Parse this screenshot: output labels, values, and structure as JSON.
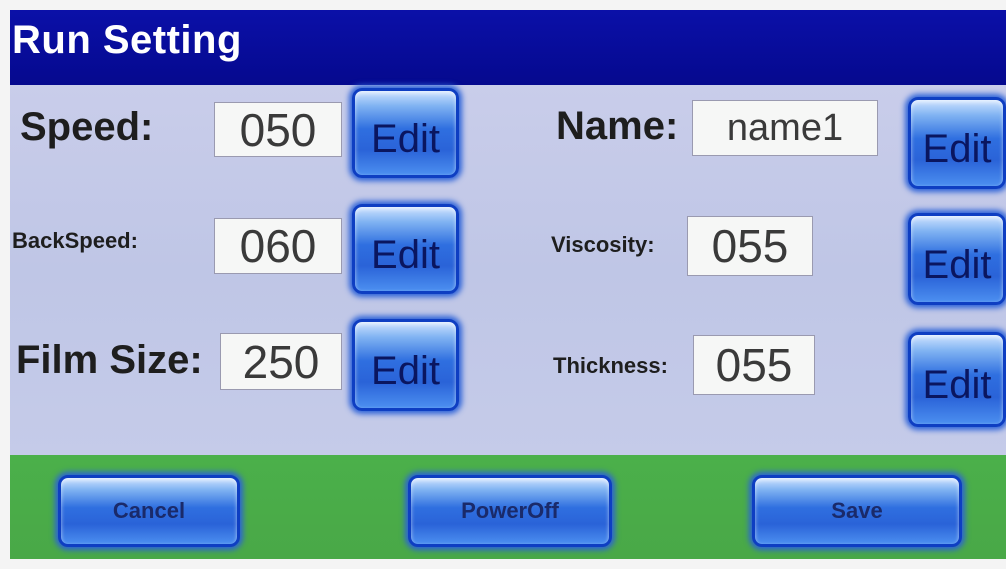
{
  "title": "Run Setting",
  "fields": {
    "speed": {
      "label": "Speed:",
      "value": "050",
      "edit_label": "Edit"
    },
    "backspeed": {
      "label": "BackSpeed:",
      "value": "060",
      "edit_label": "Edit"
    },
    "film_size": {
      "label": "Film Size:",
      "value": "250",
      "edit_label": "Edit"
    },
    "name": {
      "label": "Name:",
      "value": "name1",
      "edit_label": "Edit"
    },
    "viscosity": {
      "label": "Viscosity:",
      "value": "055",
      "edit_label": "Edit"
    },
    "thickness": {
      "label": "Thickness:",
      "value": "055",
      "edit_label": "Edit"
    }
  },
  "footer": {
    "cancel_label": "Cancel",
    "poweroff_label": "PowerOff",
    "save_label": "Save"
  },
  "colors": {
    "title_bar": "#05098e",
    "content_bg": "#c3c9e7",
    "footer_bg": "#49a847",
    "button_blue": "#2a63d8"
  }
}
